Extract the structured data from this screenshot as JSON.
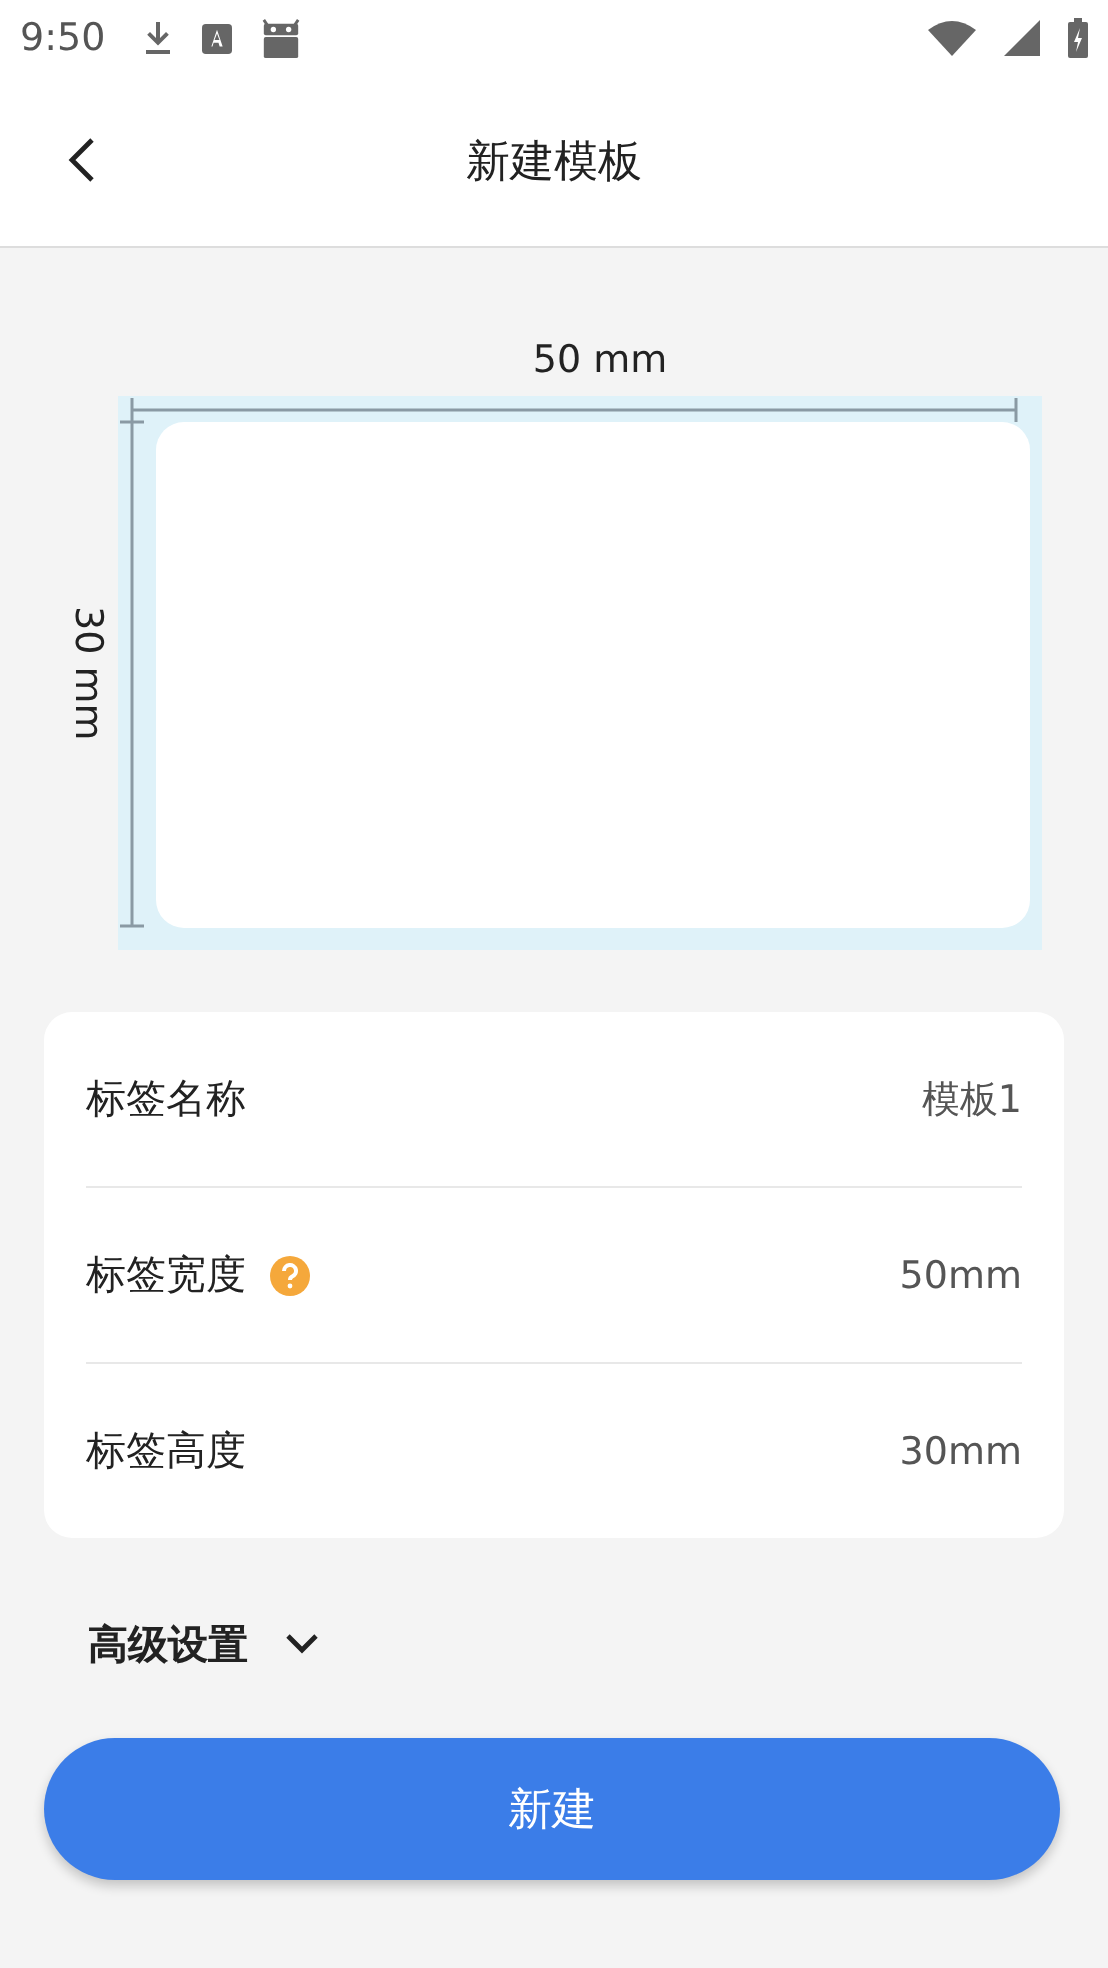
{
  "status_bar": {
    "time": "9:50"
  },
  "header": {
    "title": "新建模板"
  },
  "preview": {
    "width_label": "50 mm",
    "height_label": "30 mm"
  },
  "fields": [
    {
      "label": "标签名称",
      "value": "模板1",
      "help": false
    },
    {
      "label": "标签宽度",
      "value": "50mm",
      "help": true
    },
    {
      "label": "标签高度",
      "value": "30mm",
      "help": false
    }
  ],
  "advanced": {
    "label": "高级设置",
    "expanded": false
  },
  "submit_button": "新建"
}
